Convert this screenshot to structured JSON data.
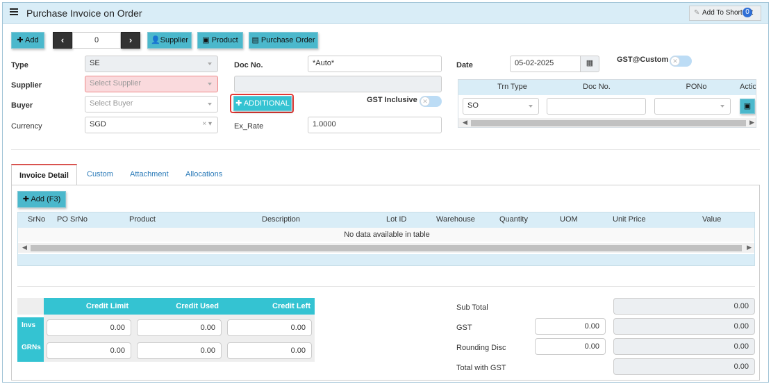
{
  "header": {
    "title": "Purchase Invoice on Order",
    "shortcut_label": "Add To ShortCut",
    "shortcut_count": "0"
  },
  "toolbar": {
    "add_label": "Add",
    "record_no": "0",
    "supplier_label": "Supplier",
    "product_label": "Product",
    "po_label": "Purchase Order",
    "additional_label": "ADDITIONAL"
  },
  "form": {
    "type_label": "Type",
    "type_value": "SE",
    "supplier_label": "Supplier",
    "supplier_placeholder": "Select Supplier",
    "buyer_label": "Buyer",
    "buyer_placeholder": "Select Buyer",
    "currency_label": "Currency",
    "currency_value": "SGD",
    "docno_label": "Doc No.",
    "docno_value": "*Auto*",
    "exrate_label": "Ex_Rate",
    "exrate_value": "1.0000",
    "gst_inclusive_label": "GST Inclusive",
    "date_label": "Date",
    "date_value": "05-02-2025",
    "gst_custom_label": "GST@Custom"
  },
  "trn_table": {
    "columns": [
      "Trn Type",
      "Doc No.",
      "PONo",
      "Action"
    ],
    "row": {
      "trn_type": "SO",
      "doc_no": "",
      "pono": ""
    }
  },
  "tabs": [
    "Invoice Detail",
    "Custom",
    "Attachment",
    "Allocations"
  ],
  "detail": {
    "add_label": "Add (F3)",
    "columns": [
      "SrNo",
      "PO SrNo",
      "Product",
      "Description",
      "Lot ID",
      "Warehouse",
      "Quantity",
      "UOM",
      "Unit Price",
      "Value"
    ],
    "empty_text": "No data available in table"
  },
  "credit": {
    "columns": [
      "Credit Limit",
      "Credit Used",
      "Credit Left"
    ],
    "rows": [
      {
        "label": "Invs",
        "values": [
          "0.00",
          "0.00",
          "0.00"
        ]
      },
      {
        "label": "GRNs",
        "values": [
          "0.00",
          "0.00",
          "0.00"
        ]
      }
    ]
  },
  "totals": {
    "subtotal_label": "Sub Total",
    "subtotal": "0.00",
    "gst_label": "GST",
    "gst_input": "0.00",
    "gst": "0.00",
    "rounding_label": "Rounding Disc",
    "rounding_input": "0.00",
    "rounding": "0.00",
    "total_label": "Total with GST",
    "total": "0.00"
  }
}
